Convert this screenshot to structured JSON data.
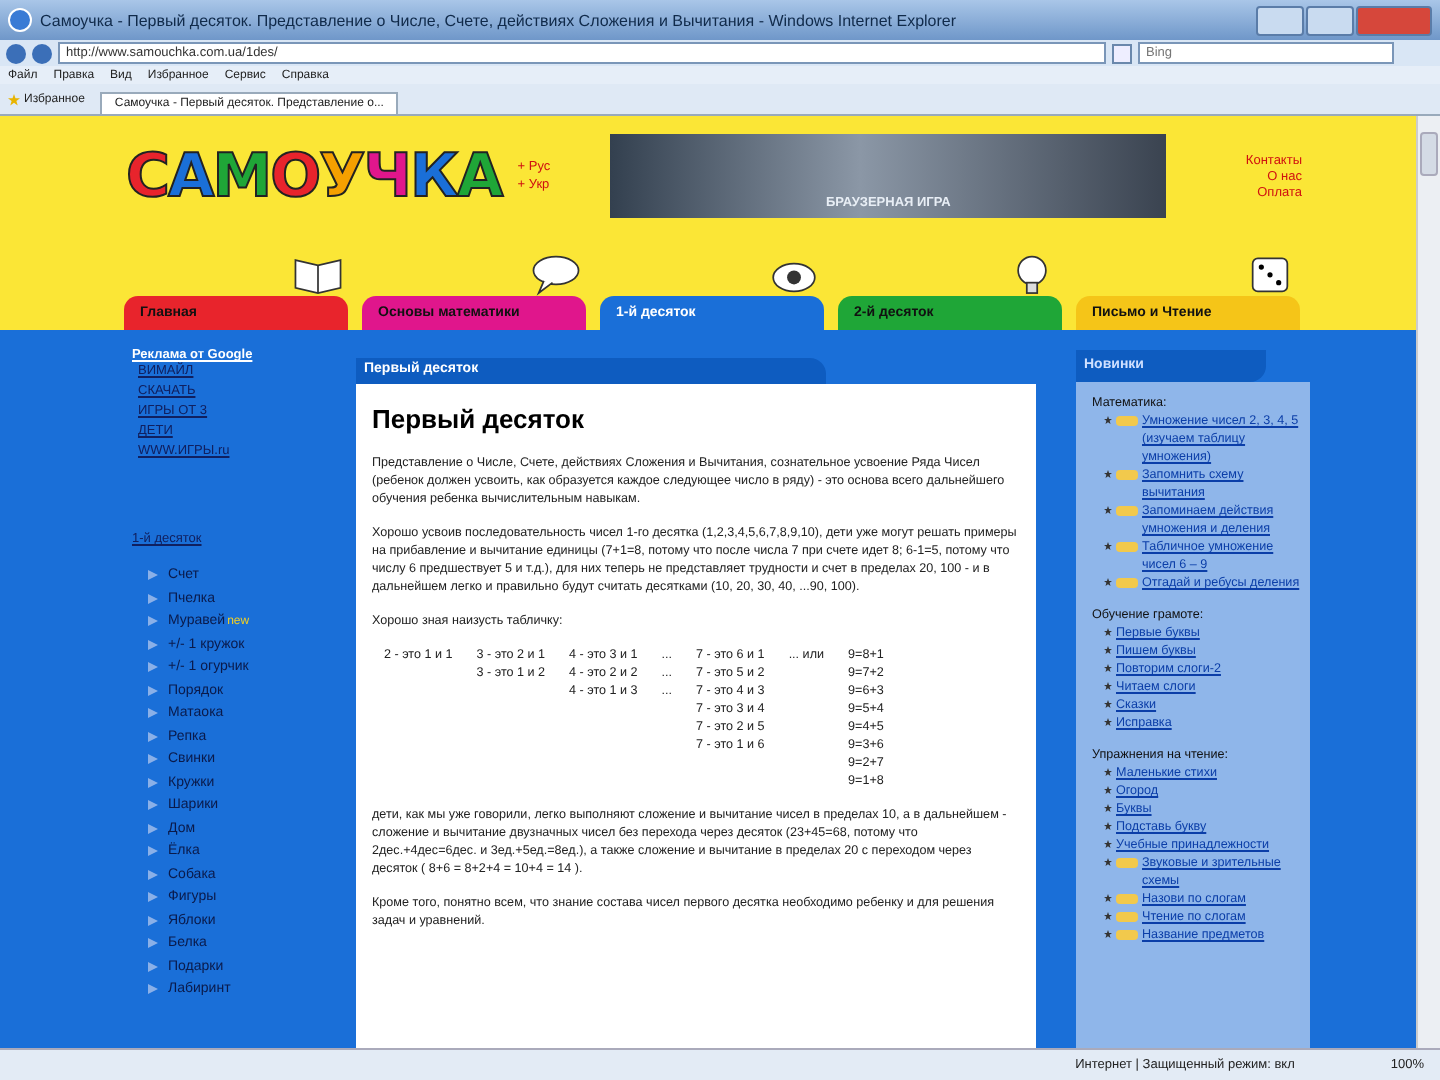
{
  "window": {
    "title": "Самоучка - Первый десяток. Представление о Числе, Счете, действиях Сложения и Вычитания - Windows Internet Explorer"
  },
  "address_bar": {
    "url": "http://www.samouchka.com.ua/1des/",
    "search_placeholder": "Bing"
  },
  "menu": [
    "Файл",
    "Правка",
    "Вид",
    "Избранное",
    "Сервис",
    "Справка"
  ],
  "favorites": "Избранное",
  "browser_tabs": [
    {
      "label": "Самоучка - Первый десяток. Представление о..."
    }
  ],
  "header": {
    "logo": "САМОУЧКА",
    "languages": [
      "+ Рус",
      "+ Укр"
    ],
    "banner_caption": "БРАУЗЕРНАЯ ИГРА",
    "links": [
      "Контакты",
      "О нас",
      "Оплата"
    ]
  },
  "nav_tabs": [
    {
      "label": "Главная",
      "color": "#e8242c",
      "selected": false
    },
    {
      "label": "Основы математики",
      "color": "#e0168c",
      "selected": false
    },
    {
      "label": "1-й десяток",
      "color": "#1a6fd8",
      "selected": true
    },
    {
      "label": "2-й десяток",
      "color": "#1fa637",
      "selected": false
    },
    {
      "label": "Письмо и Чтение",
      "color": "#f5c518",
      "selected": false
    }
  ],
  "left": {
    "ads_title": "Реклама от Google",
    "ads": [
      "ВИМАЙЛ",
      "СКАЧАТЬ",
      "ИГРЫ ОТ 3",
      "ДЕТИ",
      "WWW.ИГРЫ.ru"
    ],
    "section": "1-й десяток",
    "items": [
      {
        "label": "Счет"
      },
      {
        "label": "Пчелка"
      },
      {
        "label": "Муравей",
        "badge": "new"
      },
      {
        "label": "+/- 1 кружок"
      },
      {
        "label": "+/- 1 огурчик"
      },
      {
        "label": "Порядок"
      },
      {
        "label": "Матаока"
      },
      {
        "label": "Репка"
      },
      {
        "label": "Свинки"
      },
      {
        "label": "Кружки"
      },
      {
        "label": "Шарики"
      },
      {
        "label": "Дом"
      },
      {
        "label": "Ёлка"
      },
      {
        "label": "Собака"
      },
      {
        "label": "Фигуры"
      },
      {
        "label": "Яблоки"
      },
      {
        "label": "Белка"
      },
      {
        "label": "Подарки"
      },
      {
        "label": "Лабиринт"
      }
    ]
  },
  "content": {
    "tab_title": "Первый десяток",
    "heading": "Первый десяток",
    "paragraphs_before": [
      "Представление о Числе, Счете, действиях Сложения и Вычитания, сознательное усвоение Ряда Чисел (ребенок должен усвоить, как образуется каждое следующее число в ряду) - это основа всего дальнейшего обучения ребенка вычислительным навыкам.",
      "Хорошо усвоив последовательность чисел 1-го десятка (1,2,3,4,5,6,7,8,9,10), дети уже могут решать примеры на прибавление и вычитание единицы (7+1=8, потому что после числа 7 при счете идет 8; 6-1=5, потому что числу 6 предшествует 5 и т.д.), для них теперь не представляет трудности и счет в пределах 20, 100 - и в дальнейшем легко и правильно будут считать десятками (10, 20, 30, 40, ...90, 100).",
      "Хорошо зная наизусть табличку:"
    ],
    "table": [
      [
        "2 - это 1 и 1"
      ],
      [
        "3 - это 2 и 1",
        "3 - это 1 и 2"
      ],
      [
        "4 - это 3 и 1",
        "4 - это 2 и 2",
        "4 - это 1 и 3"
      ],
      [
        "...",
        "...",
        "..."
      ],
      [
        "7 - это 6 и 1",
        "7 - это 5 и 2",
        "7 - это 4 и 3",
        "7 - это 3 и 4",
        "7 - это 2 и 5",
        "7 - это 1 и 6"
      ],
      [
        "... или"
      ],
      [
        "9=8+1",
        "9=7+2",
        "9=6+3",
        "9=5+4",
        "9=4+5",
        "9=3+6",
        "9=2+7",
        "9=1+8"
      ]
    ],
    "paragraphs_after": [
      "дети, как мы уже говорили, легко выполняют сложение и вычитание чисел в пределах 10, а в дальнейшем - сложение и вычитание двузначных чисел без перехода через десяток (23+45=68, потому что 2дес.+4дес=6дес. и 3ед.+5ед.=8ед.), а также сложение и вычитание в пределах 20 с переходом через десяток ( 8+6 = 8+2+4 = 10+4 = 14 ).",
      "Кроме того, понятно всем, что знание состава чисел первого десятка необходимо ребенку и для решения задач и уравнений."
    ]
  },
  "right": {
    "title": "Новинки",
    "sections": [
      {
        "title": "Математика:",
        "items": [
          {
            "text": "Умножение чисел 2, 3, 4, 5 (изучаем таблицу умножения)",
            "new": true
          },
          {
            "text": "Запомнить схему вычитания",
            "new": true
          },
          {
            "text": "Запоминаем действия умножения и деления",
            "new": true
          },
          {
            "text": "Табличное умножение чисел 6 – 9",
            "new": true
          },
          {
            "text": "Отгадай и ребусы деления",
            "new": true
          }
        ]
      },
      {
        "title": "Обучение грамоте:",
        "items": [
          {
            "text": "Первые буквы",
            "new": false
          },
          {
            "text": "Пишем буквы",
            "new": false
          },
          {
            "text": "Повторим слоги-2",
            "new": false
          },
          {
            "text": "Читаем слоги",
            "new": false
          },
          {
            "text": "Сказки",
            "new": false
          },
          {
            "text": "Исправка",
            "new": false
          }
        ]
      },
      {
        "title": "Упражнения на чтение:",
        "items": [
          {
            "text": "Маленькие стихи",
            "new": false
          },
          {
            "text": "Огород",
            "new": false
          },
          {
            "text": "Буквы",
            "new": false
          },
          {
            "text": "Подставь букву",
            "new": false
          },
          {
            "text": "Учебные принадлежности",
            "new": false
          },
          {
            "text": "Звуковые и зрительные схемы",
            "new": true
          },
          {
            "text": "Назови по слогам",
            "new": true
          },
          {
            "text": "Чтение по слогам",
            "new": true
          },
          {
            "text": "Название предметов",
            "new": true
          }
        ]
      }
    ]
  },
  "status_bar": {
    "zone": "Интернет | Защищенный режим: вкл",
    "zoom": "100%"
  }
}
